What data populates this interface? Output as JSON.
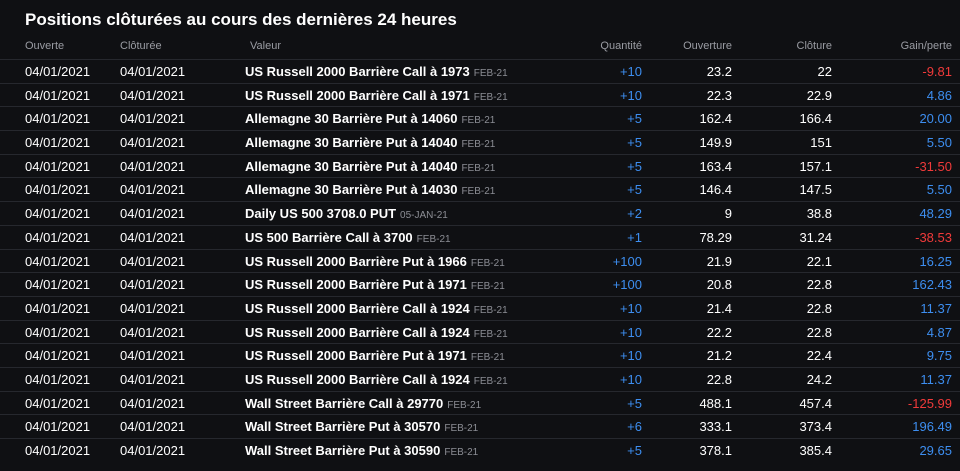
{
  "title": "Positions clôturées au cours des dernières 24 heures",
  "columns": {
    "open": "Ouverte",
    "close": "Clôturée",
    "value": "Valeur",
    "qty": "Quantité",
    "ouverture": "Ouverture",
    "cloture": "Clôture",
    "gain": "Gain/perte"
  },
  "colors": {
    "positive": "#3d8ef0",
    "negative": "#f03a3a",
    "background": "#0f1013"
  },
  "rows": [
    {
      "open": "04/01/2021",
      "close": "04/01/2021",
      "name": "US Russell 2000 Barrière Call à 1973",
      "exp": "FEB-21",
      "qty": "+10",
      "ouv": "23.2",
      "clo": "22",
      "gain": "-9.81",
      "sign": "neg"
    },
    {
      "open": "04/01/2021",
      "close": "04/01/2021",
      "name": "US Russell 2000 Barrière Call à 1971",
      "exp": "FEB-21",
      "qty": "+10",
      "ouv": "22.3",
      "clo": "22.9",
      "gain": "4.86",
      "sign": "pos"
    },
    {
      "open": "04/01/2021",
      "close": "04/01/2021",
      "name": "Allemagne 30 Barrière Put à 14060",
      "exp": "FEB-21",
      "qty": "+5",
      "ouv": "162.4",
      "clo": "166.4",
      "gain": "20.00",
      "sign": "pos"
    },
    {
      "open": "04/01/2021",
      "close": "04/01/2021",
      "name": "Allemagne 30 Barrière Put à 14040",
      "exp": "FEB-21",
      "qty": "+5",
      "ouv": "149.9",
      "clo": "151",
      "gain": "5.50",
      "sign": "pos"
    },
    {
      "open": "04/01/2021",
      "close": "04/01/2021",
      "name": "Allemagne 30 Barrière Put à 14040",
      "exp": "FEB-21",
      "qty": "+5",
      "ouv": "163.4",
      "clo": "157.1",
      "gain": "-31.50",
      "sign": "neg"
    },
    {
      "open": "04/01/2021",
      "close": "04/01/2021",
      "name": "Allemagne 30 Barrière Put à 14030",
      "exp": "FEB-21",
      "qty": "+5",
      "ouv": "146.4",
      "clo": "147.5",
      "gain": "5.50",
      "sign": "pos"
    },
    {
      "open": "04/01/2021",
      "close": "04/01/2021",
      "name": "Daily US 500 3708.0 PUT",
      "exp": "05-JAN-21",
      "qty": "+2",
      "ouv": "9",
      "clo": "38.8",
      "gain": "48.29",
      "sign": "pos"
    },
    {
      "open": "04/01/2021",
      "close": "04/01/2021",
      "name": "US 500 Barrière Call à 3700",
      "exp": "FEB-21",
      "qty": "+1",
      "ouv": "78.29",
      "clo": "31.24",
      "gain": "-38.53",
      "sign": "neg"
    },
    {
      "open": "04/01/2021",
      "close": "04/01/2021",
      "name": "US Russell 2000 Barrière Put à 1966",
      "exp": "FEB-21",
      "qty": "+100",
      "ouv": "21.9",
      "clo": "22.1",
      "gain": "16.25",
      "sign": "pos"
    },
    {
      "open": "04/01/2021",
      "close": "04/01/2021",
      "name": "US Russell 2000 Barrière Put à 1971",
      "exp": "FEB-21",
      "qty": "+100",
      "ouv": "20.8",
      "clo": "22.8",
      "gain": "162.43",
      "sign": "pos"
    },
    {
      "open": "04/01/2021",
      "close": "04/01/2021",
      "name": "US Russell 2000 Barrière Call à 1924",
      "exp": "FEB-21",
      "qty": "+10",
      "ouv": "21.4",
      "clo": "22.8",
      "gain": "11.37",
      "sign": "pos"
    },
    {
      "open": "04/01/2021",
      "close": "04/01/2021",
      "name": "US Russell 2000 Barrière Call à 1924",
      "exp": "FEB-21",
      "qty": "+10",
      "ouv": "22.2",
      "clo": "22.8",
      "gain": "4.87",
      "sign": "pos"
    },
    {
      "open": "04/01/2021",
      "close": "04/01/2021",
      "name": "US Russell 2000 Barrière Put à 1971",
      "exp": "FEB-21",
      "qty": "+10",
      "ouv": "21.2",
      "clo": "22.4",
      "gain": "9.75",
      "sign": "pos"
    },
    {
      "open": "04/01/2021",
      "close": "04/01/2021",
      "name": "US Russell 2000 Barrière Call à 1924",
      "exp": "FEB-21",
      "qty": "+10",
      "ouv": "22.8",
      "clo": "24.2",
      "gain": "11.37",
      "sign": "pos"
    },
    {
      "open": "04/01/2021",
      "close": "04/01/2021",
      "name": "Wall Street Barrière Call à 29770",
      "exp": "FEB-21",
      "qty": "+5",
      "ouv": "488.1",
      "clo": "457.4",
      "gain": "-125.99",
      "sign": "neg"
    },
    {
      "open": "04/01/2021",
      "close": "04/01/2021",
      "name": "Wall Street Barrière Put à 30570",
      "exp": "FEB-21",
      "qty": "+6",
      "ouv": "333.1",
      "clo": "373.4",
      "gain": "196.49",
      "sign": "pos"
    },
    {
      "open": "04/01/2021",
      "close": "04/01/2021",
      "name": "Wall Street Barrière Put à 30590",
      "exp": "FEB-21",
      "qty": "+5",
      "ouv": "378.1",
      "clo": "385.4",
      "gain": "29.65",
      "sign": "pos"
    }
  ]
}
